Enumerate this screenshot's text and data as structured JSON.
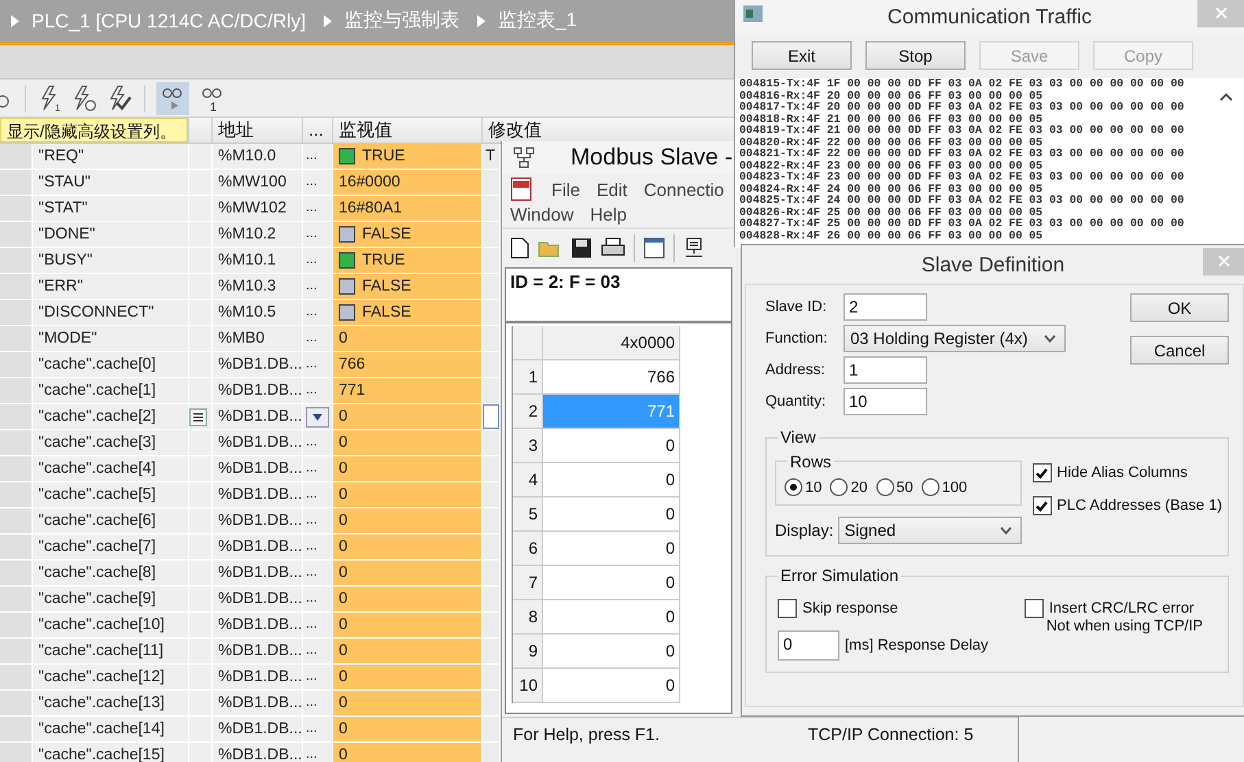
{
  "tia": {
    "toolbar_badges": [
      "1",
      "1"
    ],
    "breadcrumb": [
      "PLC_1 [CPU 1214C AC/DC/Rly]",
      "监控与强制表",
      "监控表_1"
    ],
    "tooltip": "显示/隐藏高级设置列。",
    "columns": [
      "地址",
      "...",
      "监视值",
      "修改值"
    ],
    "rows": [
      {
        "name": "\"REQ\"",
        "address": "%M10.0",
        "dots": "...",
        "value": "TRUE",
        "bool": true,
        "modify": "T",
        "editing": false
      },
      {
        "name": "\"STAU\"",
        "address": "%MW100",
        "dots": "...",
        "value": "16#0000",
        "modify": "",
        "editing": false
      },
      {
        "name": "\"STAT\"",
        "address": "%MW102",
        "dots": "...",
        "value": "16#80A1",
        "modify": "",
        "editing": false
      },
      {
        "name": "\"DONE\"",
        "address": "%M10.2",
        "dots": "...",
        "value": "FALSE",
        "bool": false,
        "modify": "",
        "editing": false
      },
      {
        "name": "\"BUSY\"",
        "address": "%M10.1",
        "dots": "...",
        "value": "TRUE",
        "bool": true,
        "modify": "",
        "editing": false
      },
      {
        "name": "\"ERR\"",
        "address": "%M10.3",
        "dots": "...",
        "value": "FALSE",
        "bool": false,
        "modify": "",
        "editing": false
      },
      {
        "name": "\"DISCONNECT\"",
        "address": "%M10.5",
        "dots": "...",
        "value": "FALSE",
        "bool": false,
        "modify": "",
        "editing": false
      },
      {
        "name": "\"MODE\"",
        "address": "%MB0",
        "dots": "...",
        "value": "0",
        "modify": "",
        "editing": false
      },
      {
        "name": "\"cache\".cache[0]",
        "address": "%DB1.DB...",
        "dots": "...",
        "value": "766",
        "modify": "",
        "editing": false
      },
      {
        "name": "\"cache\".cache[1]",
        "address": "%DB1.DB...",
        "dots": "...",
        "value": "771",
        "modify": "",
        "editing": false
      },
      {
        "name": "\"cache\".cache[2]",
        "address": "%DB1.DB...",
        "dots": "",
        "value": "0",
        "modify": "",
        "editing": true
      },
      {
        "name": "\"cache\".cache[3]",
        "address": "%DB1.DB...",
        "dots": "...",
        "value": "0",
        "modify": "",
        "editing": false
      },
      {
        "name": "\"cache\".cache[4]",
        "address": "%DB1.DB...",
        "dots": "...",
        "value": "0",
        "modify": "",
        "editing": false
      },
      {
        "name": "\"cache\".cache[5]",
        "address": "%DB1.DB...",
        "dots": "...",
        "value": "0",
        "modify": "",
        "editing": false
      },
      {
        "name": "\"cache\".cache[6]",
        "address": "%DB1.DB...",
        "dots": "...",
        "value": "0",
        "modify": "",
        "editing": false
      },
      {
        "name": "\"cache\".cache[7]",
        "address": "%DB1.DB...",
        "dots": "...",
        "value": "0",
        "modify": "",
        "editing": false
      },
      {
        "name": "\"cache\".cache[8]",
        "address": "%DB1.DB...",
        "dots": "...",
        "value": "0",
        "modify": "",
        "editing": false
      },
      {
        "name": "\"cache\".cache[9]",
        "address": "%DB1.DB...",
        "dots": "...",
        "value": "0",
        "modify": "",
        "editing": false
      },
      {
        "name": "\"cache\".cache[10]",
        "address": "%DB1.DB...",
        "dots": "...",
        "value": "0",
        "modify": "",
        "editing": false
      },
      {
        "name": "\"cache\".cache[11]",
        "address": "%DB1.DB...",
        "dots": "...",
        "value": "0",
        "modify": "",
        "editing": false
      },
      {
        "name": "\"cache\".cache[12]",
        "address": "%DB1.DB...",
        "dots": "...",
        "value": "0",
        "modify": "",
        "editing": false
      },
      {
        "name": "\"cache\".cache[13]",
        "address": "%DB1.DB...",
        "dots": "...",
        "value": "0",
        "modify": "",
        "editing": false
      },
      {
        "name": "\"cache\".cache[14]",
        "address": "%DB1.DB...",
        "dots": "...",
        "value": "0",
        "modify": "",
        "editing": false
      },
      {
        "name": "\"cache\".cache[15]",
        "address": "%DB1.DB...",
        "dots": "...",
        "value": "0",
        "modify": "",
        "editing": false
      }
    ]
  },
  "modbus": {
    "title": "Modbus Slave -",
    "menu": [
      "File",
      "Edit",
      "Connectio",
      "Window",
      "Help"
    ],
    "doc_title": "ID = 2: F = 03",
    "column": "4x0000",
    "rows": [
      {
        "index": "1",
        "value": "766",
        "selected": false
      },
      {
        "index": "2",
        "value": "771",
        "selected": true
      },
      {
        "index": "3",
        "value": "0",
        "selected": false
      },
      {
        "index": "4",
        "value": "0",
        "selected": false
      },
      {
        "index": "5",
        "value": "0",
        "selected": false
      },
      {
        "index": "6",
        "value": "0",
        "selected": false
      },
      {
        "index": "7",
        "value": "0",
        "selected": false
      },
      {
        "index": "8",
        "value": "0",
        "selected": false
      },
      {
        "index": "9",
        "value": "0",
        "selected": false
      },
      {
        "index": "10",
        "value": "0",
        "selected": false
      }
    ],
    "status_bar": [
      "For Help, press F1.",
      "TCP/IP Connection: 5"
    ]
  },
  "traffic": {
    "title": "Communication Traffic",
    "buttons": [
      {
        "label": "Exit",
        "disabled": false
      },
      {
        "label": "Stop",
        "disabled": false
      },
      {
        "label": "Save",
        "disabled": true
      },
      {
        "label": "Copy",
        "disabled": true
      }
    ],
    "log": [
      "004815-Tx:4F 1F 00 00 00 0D FF 03 0A 02 FE 03 03 00 00 00 00 00 00",
      "004816-Rx:4F 20 00 00 00 06 FF 03 00 00 00 05",
      "004817-Tx:4F 20 00 00 00 0D FF 03 0A 02 FE 03 03 00 00 00 00 00 00",
      "004818-Rx:4F 21 00 00 00 06 FF 03 00 00 00 05",
      "004819-Tx:4F 21 00 00 00 0D FF 03 0A 02 FE 03 03 00 00 00 00 00 00",
      "004820-Rx:4F 22 00 00 00 06 FF 03 00 00 00 05",
      "004821-Tx:4F 22 00 00 00 0D FF 03 0A 02 FE 03 03 00 00 00 00 00 00",
      "004822-Rx:4F 23 00 00 00 06 FF 03 00 00 00 05",
      "004823-Tx:4F 23 00 00 00 0D FF 03 0A 02 FE 03 03 00 00 00 00 00 00",
      "004824-Rx:4F 24 00 00 00 06 FF 03 00 00 00 05",
      "004825-Tx:4F 24 00 00 00 0D FF 03 0A 02 FE 03 03 00 00 00 00 00 00",
      "004826-Rx:4F 25 00 00 00 06 FF 03 00 00 00 05",
      "004827-Tx:4F 25 00 00 00 0D FF 03 0A 02 FE 03 03 00 00 00 00 00 00",
      "004828-Rx:4F 26 00 00 00 06 FF 03 00 00 00 05"
    ]
  },
  "slave_definition": {
    "title": "Slave Definition",
    "fields": [
      {
        "label": "Slave ID:",
        "value": "2"
      },
      {
        "label": "Function:",
        "value": "03 Holding Register (4x)",
        "kind": "select"
      },
      {
        "label": "Address:",
        "value": "1"
      },
      {
        "label": "Quantity:",
        "value": "10"
      }
    ],
    "buttons": [
      "OK",
      "Cancel"
    ],
    "view": {
      "title": "View",
      "rows_title": "Rows",
      "rows": [
        {
          "label": "10",
          "selected": true
        },
        {
          "label": "20",
          "selected": false
        },
        {
          "label": "50",
          "selected": false
        },
        {
          "label": "100",
          "selected": false
        }
      ],
      "checks": [
        {
          "label": "Hide Alias Columns",
          "checked": true
        },
        {
          "label": "PLC Addresses (Base 1)",
          "checked": true
        }
      ],
      "display_label": "Display:",
      "display": "Signed"
    },
    "error_simulation": {
      "title": "Error Simulation",
      "skip_response": {
        "label": "Skip response",
        "checked": false
      },
      "crc_error": {
        "label": "Insert CRC/LRC error",
        "checked": false
      },
      "note": "Not when using TCP/IP",
      "delay": "0",
      "delay_label": "[ms] Response Delay"
    }
  }
}
